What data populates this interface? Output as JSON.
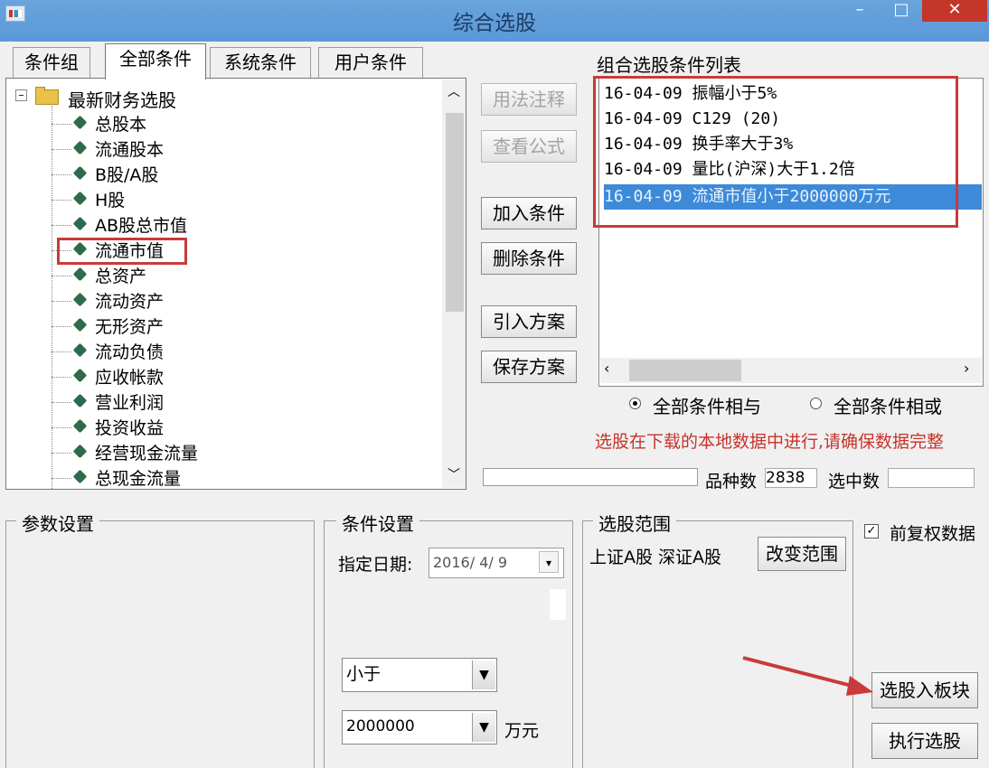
{
  "window": {
    "title": "综合选股",
    "minimize": "–",
    "maximize": "□",
    "close": "✕"
  },
  "tabs": [
    "条件组",
    "全部条件",
    "系统条件",
    "用户条件"
  ],
  "tree": {
    "root_label": "最新财务选股",
    "items": [
      "总股本",
      "流通股本",
      "B股/A股",
      "H股",
      "AB股总市值",
      "流通市值",
      "总资产",
      "流动资产",
      "无形资产",
      "流动负债",
      "应收帐款",
      "营业利润",
      "投资收益",
      "经营现金流量",
      "总现金流量"
    ],
    "highlighted_item": "流通市值"
  },
  "middle_buttons": {
    "usage_notes": "用法注释",
    "view_formula": "查看公式",
    "add_condition": "加入条件",
    "delete_condition": "删除条件",
    "import_scheme": "引入方案",
    "save_scheme": "保存方案"
  },
  "condition_list": {
    "title": "组合选股条件列表",
    "rows": [
      "16-04-09 振幅小于5%",
      "16-04-09 C129 (20)",
      "16-04-09 换手率大于3%",
      "16-04-09 量比(沪深)大于1.2倍",
      "16-04-09 流通市值小于2000000万元"
    ],
    "selected_index": 4
  },
  "logic": {
    "and_label": "全部条件相与",
    "or_label": "全部条件相或",
    "selected": "and"
  },
  "warning_text": "选股在下载的本地数据中进行,请确保数据完整",
  "stats": {
    "count_label": "品种数",
    "count_value": "2838",
    "selected_label": "选中数",
    "selected_value": ""
  },
  "param_settings": {
    "title": "参数设置"
  },
  "condition_settings": {
    "title": "条件设置",
    "date_label": "指定日期:",
    "date_value": "2016/ 4/ 9",
    "operator_value": "小于",
    "amount_value": "2000000",
    "unit": "万元"
  },
  "stock_range": {
    "title": "选股范围",
    "range_text": "上证A股 深证A股",
    "change_range_button": "改变范围"
  },
  "options": {
    "adjusted_label": "前复权数据",
    "adjusted_checked": true
  },
  "actions": {
    "to_block": "选股入板块",
    "run": "执行选股"
  },
  "colors": {
    "titlebar": "#5b98d8",
    "close": "#c4352a",
    "selection": "#3c8ad8",
    "warning": "#c8332b",
    "annotation": "#c93a3a"
  }
}
